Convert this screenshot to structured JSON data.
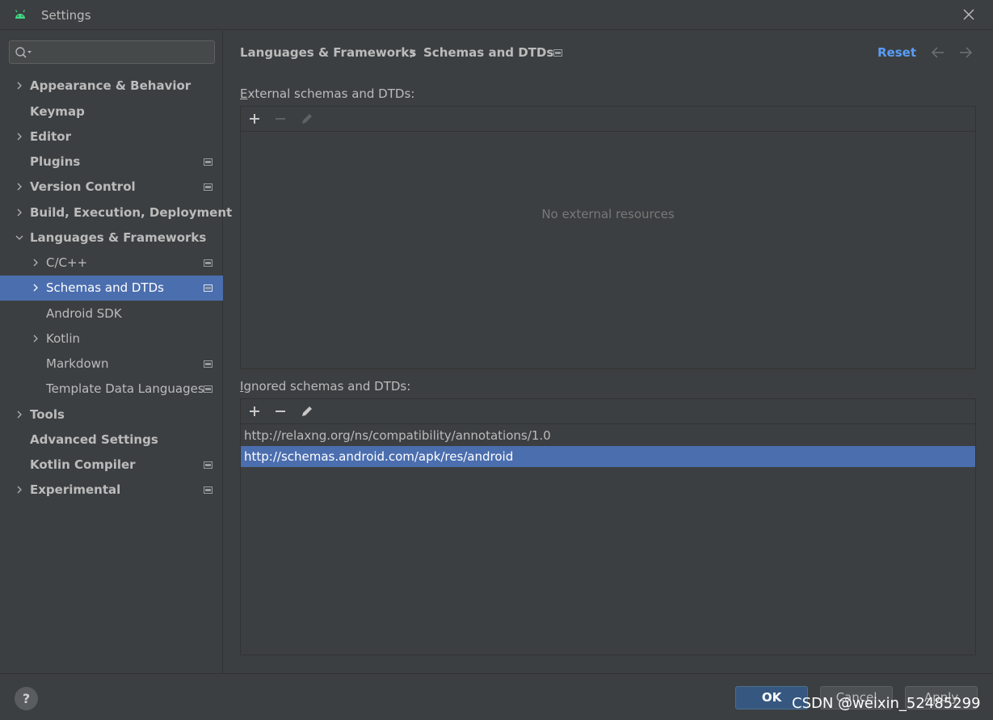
{
  "window": {
    "title": "Settings",
    "app_icon": "android-icon",
    "close_icon": "close-icon"
  },
  "search": {
    "placeholder": "",
    "value": ""
  },
  "sidebar": {
    "items": [
      {
        "label": "Appearance & Behavior"
      },
      {
        "label": "Keymap"
      },
      {
        "label": "Editor"
      },
      {
        "label": "Plugins"
      },
      {
        "label": "Version Control"
      },
      {
        "label": "Build, Execution, Deployment"
      },
      {
        "label": "Languages & Frameworks"
      },
      {
        "label": "C/C++"
      },
      {
        "label": "Schemas and DTDs"
      },
      {
        "label": "Android SDK"
      },
      {
        "label": "Kotlin"
      },
      {
        "label": "Markdown"
      },
      {
        "label": "Template Data Languages"
      },
      {
        "label": "Tools"
      },
      {
        "label": "Advanced Settings"
      },
      {
        "label": "Kotlin Compiler"
      },
      {
        "label": "Experimental"
      }
    ]
  },
  "header": {
    "breadcrumb_parent": "Languages & Frameworks",
    "breadcrumb_current": "Schemas and DTDs",
    "reset_label": "Reset"
  },
  "external": {
    "label_accel": "E",
    "label_rest": "xternal schemas and DTDs:",
    "empty_text": "No external resources"
  },
  "ignored": {
    "label_accel": "I",
    "label_rest": "gnored schemas and DTDs:",
    "rows": [
      "http://relaxng.org/ns/compatibility/annotations/1.0",
      "http://schemas.android.com/apk/res/android"
    ]
  },
  "footer": {
    "help_label": "?",
    "ok_label": "OK",
    "cancel_label": "Cancel",
    "apply_label": "Apply"
  },
  "watermark": "CSDN @weixin_52485299",
  "colors": {
    "background": "#3c3f41",
    "selection": "#4b6eaf",
    "accent_link": "#589df6",
    "ok_button": "#365880",
    "android_green": "#3ddc84"
  }
}
